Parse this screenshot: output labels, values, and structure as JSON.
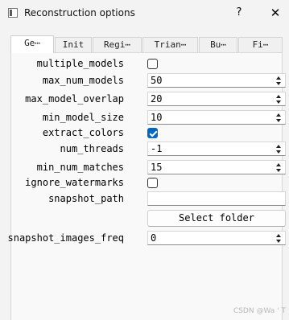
{
  "window": {
    "title": "Reconstruction options",
    "help_label": "?",
    "close_label": "✕"
  },
  "tabs": [
    {
      "label": "Ge⋯",
      "active": true
    },
    {
      "label": "Init",
      "active": false
    },
    {
      "label": "Regi⋯",
      "active": false
    },
    {
      "label": "Trian⋯",
      "active": false
    },
    {
      "label": "Bu⋯",
      "active": false
    },
    {
      "label": "Fi⋯",
      "active": false
    }
  ],
  "options": {
    "multiple_models": {
      "label": "multiple_models",
      "checked": false
    },
    "max_num_models": {
      "label": "max_num_models",
      "value": "50"
    },
    "max_model_overlap": {
      "label": "max_model_overlap",
      "value": "20"
    },
    "min_model_size": {
      "label": "min_model_size",
      "value": "10"
    },
    "extract_colors": {
      "label": "extract_colors",
      "checked": true
    },
    "num_threads": {
      "label": "num_threads",
      "value": "-1"
    },
    "min_num_matches": {
      "label": "min_num_matches",
      "value": "15"
    },
    "ignore_watermarks": {
      "label": "ignore_watermarks",
      "checked": false
    },
    "snapshot_path": {
      "label": "snapshot_path",
      "value": ""
    },
    "select_folder_label": "Select folder",
    "snapshot_images_freq": {
      "label": "snapshot_images_freq",
      "value": "0"
    }
  },
  "colors": {
    "accent": "#0067c0",
    "background": "#f3f3f3",
    "panel": "#f9f9f9"
  },
  "watermark": "CSDN @Wa ' T"
}
